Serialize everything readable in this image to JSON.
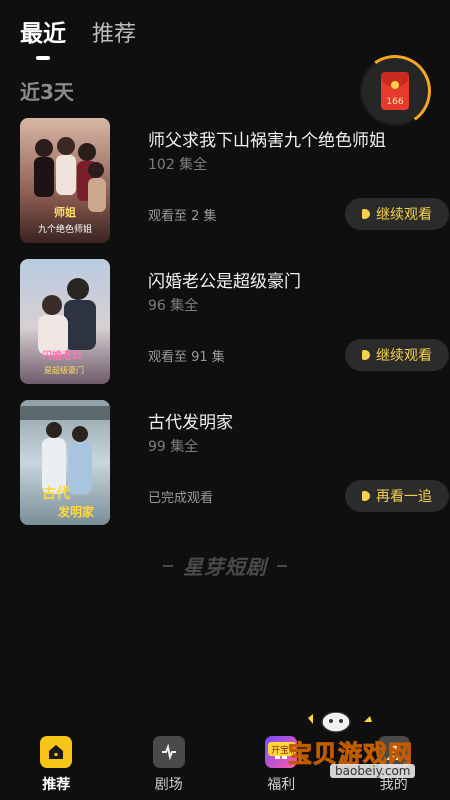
{
  "header": {
    "tabs": [
      {
        "label": "最近",
        "active": true
      },
      {
        "label": "推荐",
        "active": false
      }
    ],
    "section_title": "近3天"
  },
  "red_packet": {
    "count": "166",
    "icon": "red-envelope-icon"
  },
  "history": [
    {
      "title": "师父求我下山祸害九个绝色师姐",
      "episodes": "102 集全",
      "progress": "观看至 2 集",
      "action": "继续观看"
    },
    {
      "title": "闪婚老公是超级豪门",
      "episodes": "96 集全",
      "progress": "观看至 91 集",
      "action": "继续观看"
    },
    {
      "title": "古代发明家",
      "episodes": "99 集全",
      "progress": "已完成观看",
      "action": "再看一追"
    }
  ],
  "brand": "星芽短剧",
  "bottom_nav": [
    {
      "label": "推荐",
      "active": true,
      "icon": "home-icon"
    },
    {
      "label": "剧场",
      "active": false,
      "icon": "tv-icon"
    },
    {
      "label": "福利",
      "active": false,
      "icon": "gift-icon"
    },
    {
      "label": "我的",
      "active": false,
      "icon": "profile-icon"
    }
  ],
  "watermark": {
    "text": "宝贝游戏网",
    "url": "baobeiy.com",
    "badge": "开宝箱"
  },
  "colors": {
    "accent": "#f5d24b",
    "background": "#0f0f0f",
    "red_packet": "#e63a2c"
  }
}
